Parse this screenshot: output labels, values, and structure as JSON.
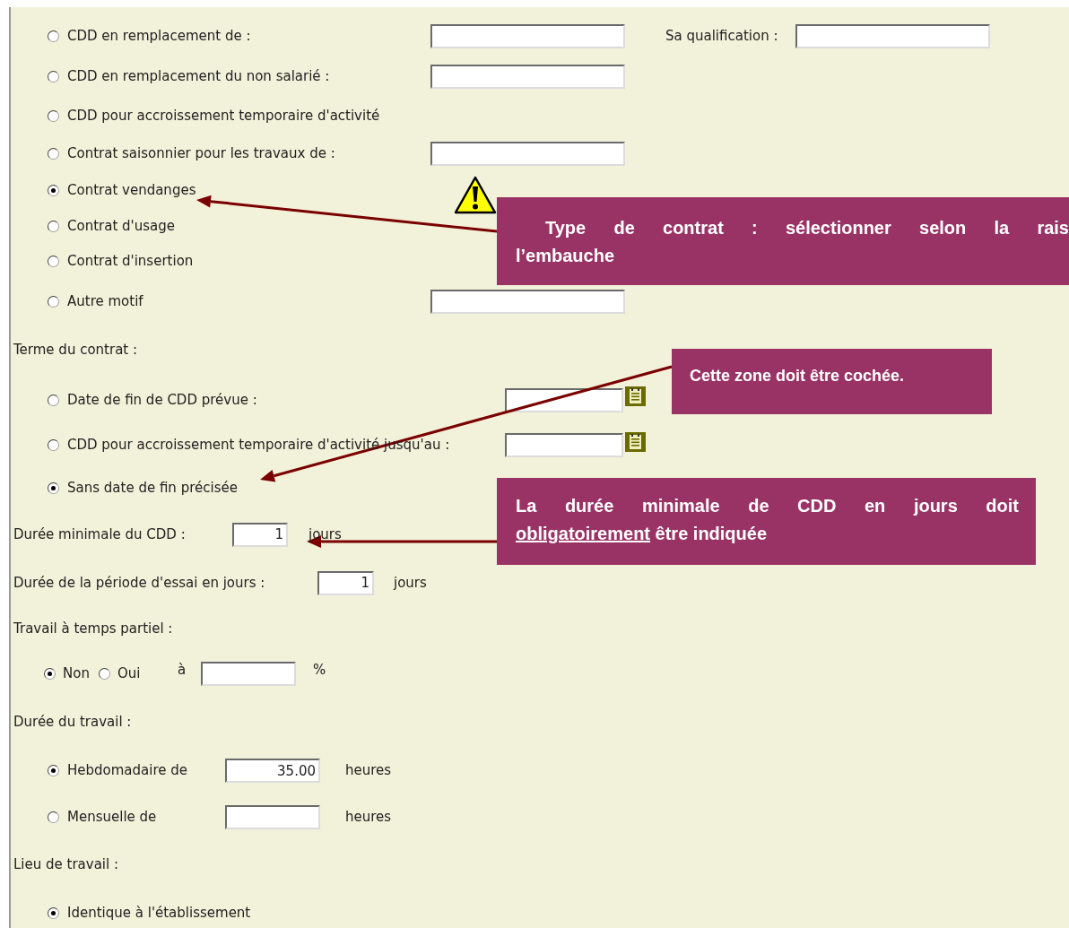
{
  "contract_reason": {
    "options": [
      {
        "label": "CDD en remplacement de :",
        "selected": false,
        "field": true
      },
      {
        "label": "CDD en remplacement du non salarié :",
        "selected": false,
        "field": true
      },
      {
        "label": "CDD pour accroissement temporaire d'activité",
        "selected": false,
        "field": false
      },
      {
        "label": "Contrat saisonnier pour les travaux de :",
        "selected": false,
        "field": true
      },
      {
        "label": "Contrat vendanges",
        "selected": true,
        "field": false
      },
      {
        "label": "Contrat d'usage",
        "selected": false,
        "field": false
      },
      {
        "label": "Contrat d'insertion",
        "selected": false,
        "field": false
      },
      {
        "label": "Autre motif",
        "selected": false,
        "field": true
      }
    ],
    "qualification_label": "Sa qualification :"
  },
  "term": {
    "label": "Terme du contrat :",
    "options": [
      {
        "label": "Date de fin de CDD prévue :",
        "selected": false,
        "date_field": true
      },
      {
        "label": "CDD pour accroissement temporaire d'activité jusqu'au :",
        "selected": false,
        "date_field": true
      },
      {
        "label": "Sans date de fin précisée",
        "selected": true,
        "date_field": false
      }
    ]
  },
  "min_duration": {
    "label": "Durée minimale du CDD :",
    "value": "1",
    "unit": "jours"
  },
  "trial_period": {
    "label": "Durée de la période d'essai en jours :",
    "value": "1",
    "unit": "jours"
  },
  "part_time": {
    "label": "Travail à temps partiel :",
    "options": [
      {
        "label": "Non",
        "selected": true
      },
      {
        "label": "Oui",
        "selected": false
      }
    ],
    "rate_prefix": "à",
    "rate_unit": "%"
  },
  "work_duration": {
    "label": "Durée du travail :",
    "options": [
      {
        "label": "Hebdomadaire de",
        "selected": true,
        "value": "35.00",
        "unit": "heures"
      },
      {
        "label": "Mensuelle de",
        "selected": false,
        "unit": "heures"
      }
    ]
  },
  "workplace": {
    "label": "Lieu de travail :",
    "options": [
      {
        "label": "Identique à l'établissement",
        "selected": true
      }
    ]
  },
  "callouts": [
    {
      "lines": [
        [
          {
            "text": "Type de contrat : sélectionner selon la rais"
          }
        ],
        [
          {
            "text": "l’embauche"
          }
        ]
      ]
    },
    {
      "lines": [
        [
          {
            "text": "Cette zone doit être cochée."
          }
        ]
      ]
    },
    {
      "lines": [
        [
          {
            "text": "La durée minimale de CDD en jours doit"
          }
        ],
        [
          {
            "text": "obligatoirement",
            "underlined": true
          },
          {
            "text": " être indiquée"
          }
        ]
      ]
    }
  ]
}
